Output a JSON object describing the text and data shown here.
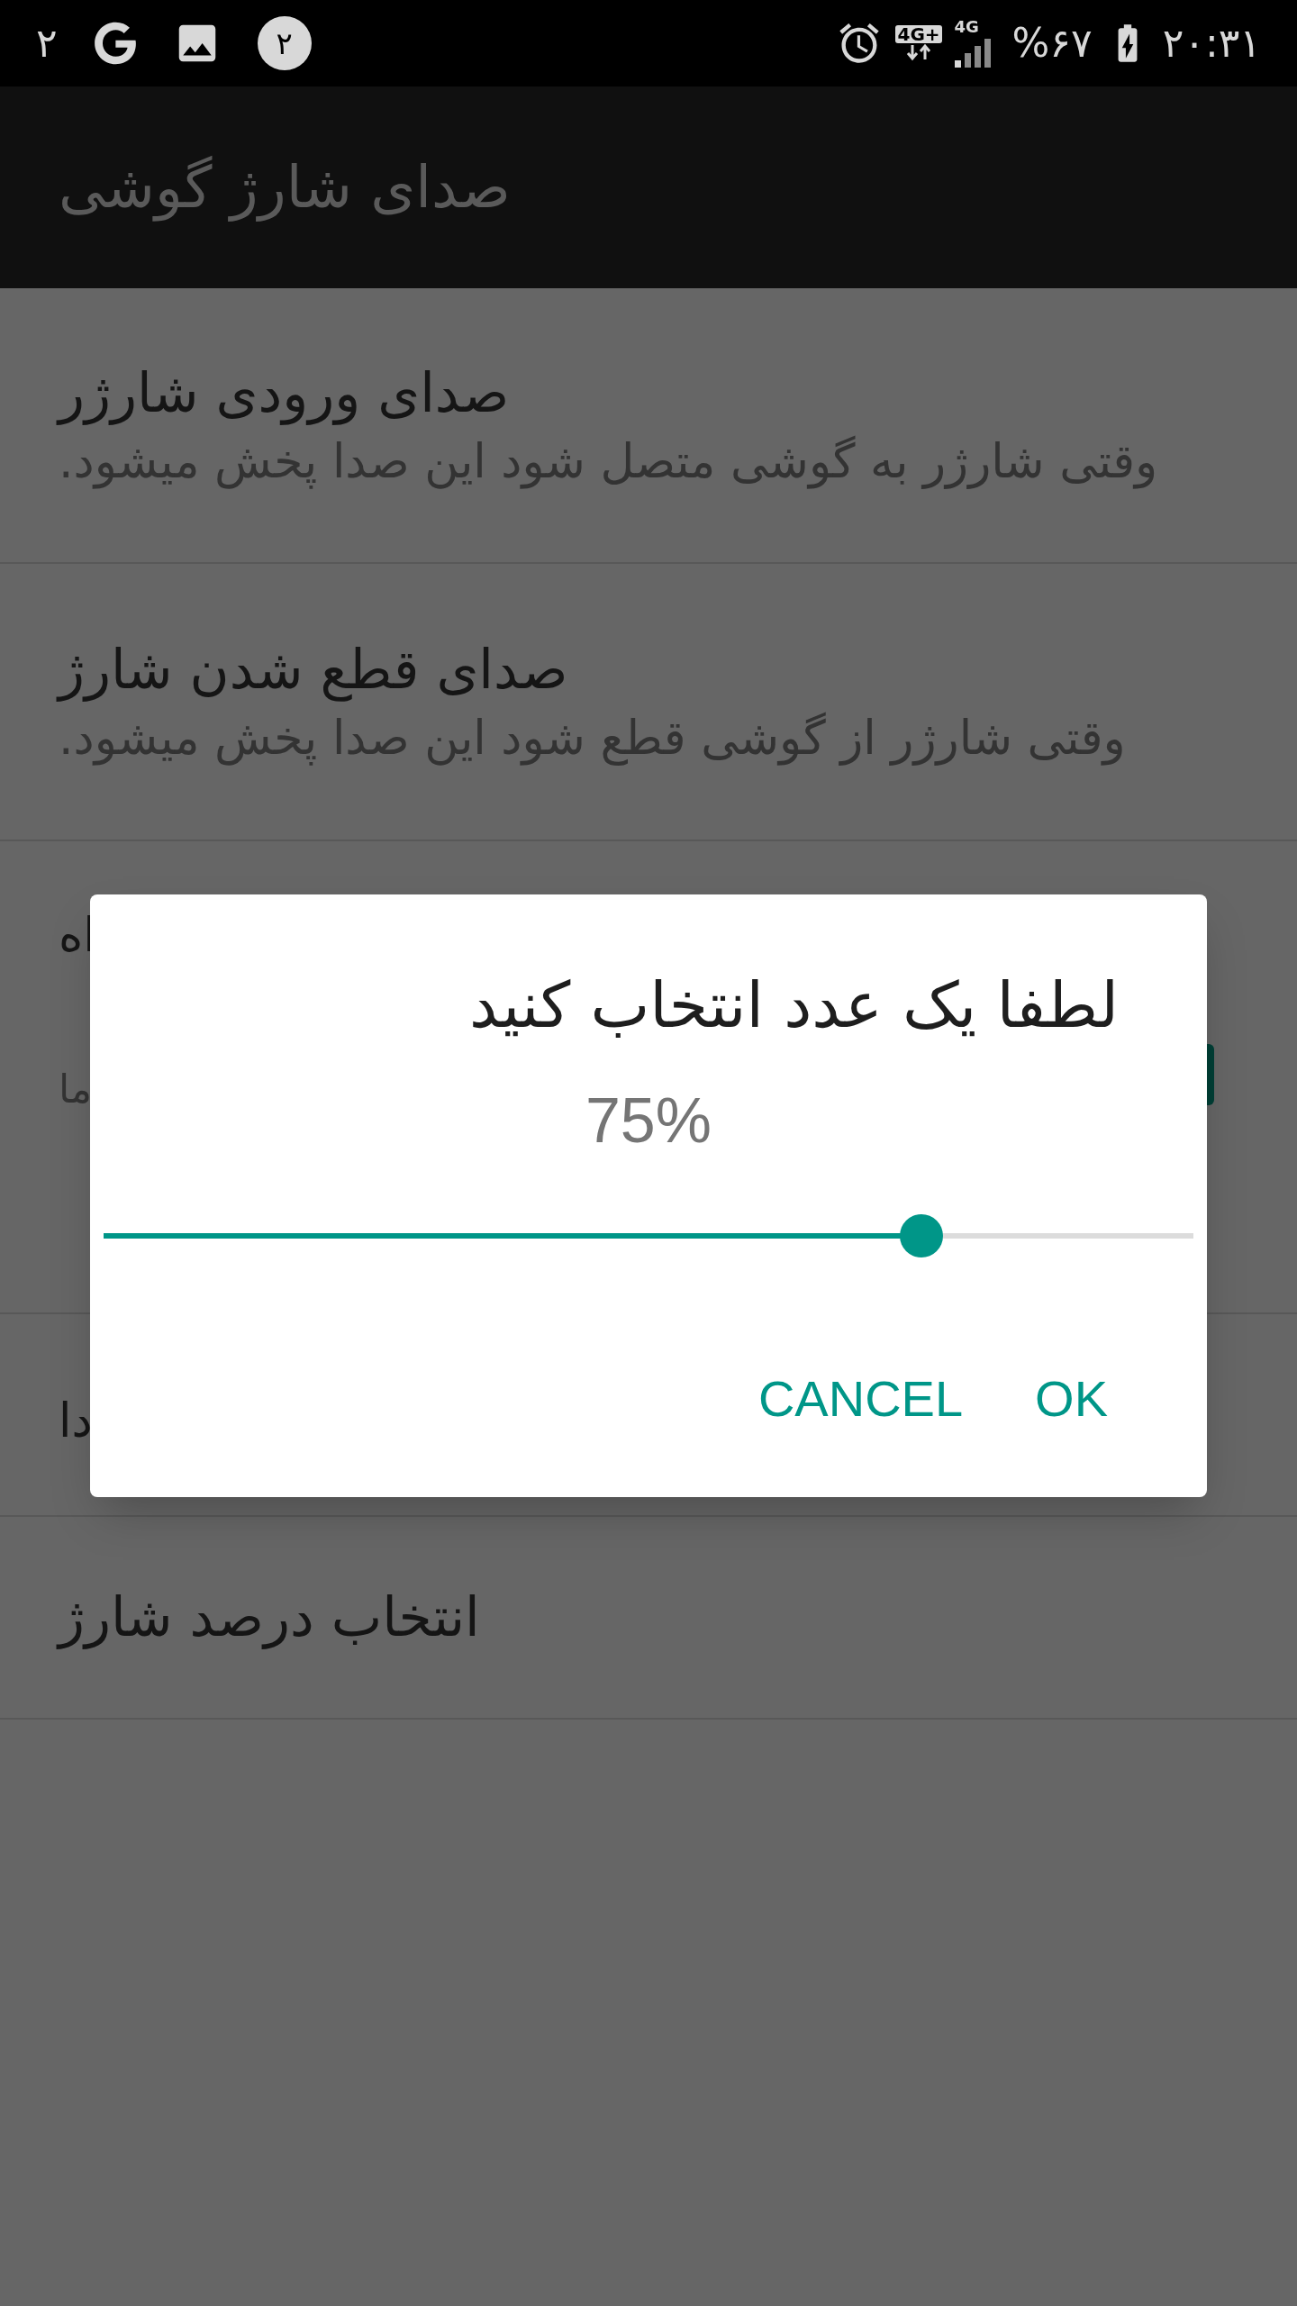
{
  "status_bar": {
    "notification_count": "۲",
    "badge": "۲",
    "network": "4G+",
    "signal_label": "4G",
    "battery": "%۶۷",
    "time": "۲۰:۳۱"
  },
  "app_bar": {
    "title": "صدای شارژ گوشی"
  },
  "settings": [
    {
      "kind": "full",
      "title": "صدای ورودی شارژر",
      "subtitle": "وقتی شارژر به گوشی متصل شود این صدا پخش میشود."
    },
    {
      "kind": "full",
      "title": "صدای قطع شدن شارژ",
      "subtitle": "وقتی شارژر از گوشی قطع شود این صدا پخش میشود."
    },
    {
      "kind": "partial",
      "title": "اه",
      "subtitle": "ما",
      "has_button": true
    },
    {
      "kind": "partial",
      "title": "دا"
    },
    {
      "kind": "full",
      "title": "انتخاب درصد شارژ"
    }
  ],
  "dialog": {
    "title": "لطفا یک عدد انتخاب کنید",
    "value": "75%",
    "slider": {
      "level": 0.75
    },
    "buttons": [
      "OK",
      "CANCEL"
    ]
  }
}
